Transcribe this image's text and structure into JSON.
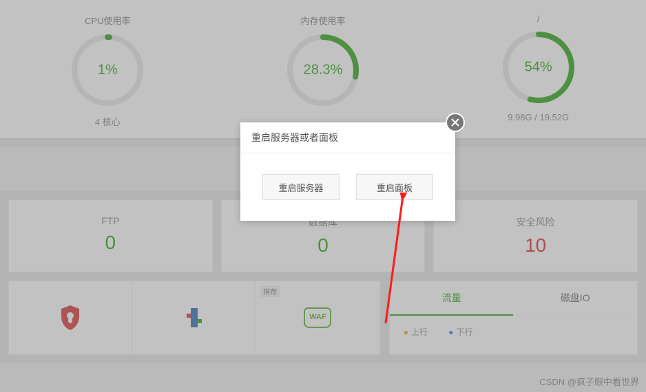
{
  "gauges": {
    "cpu": {
      "title": "CPU使用率",
      "value": "1%",
      "pct": 1,
      "sub": "4 核心"
    },
    "mem": {
      "title": "内存使用率",
      "value": "28.3%",
      "pct": 28.3,
      "sub": ""
    },
    "disk": {
      "title": "/",
      "value": "54%",
      "pct": 54,
      "sub": "9.98G / 19.52G"
    }
  },
  "stats": {
    "ftp": {
      "label": "FTP",
      "value": "0"
    },
    "db": {
      "label": "数据库",
      "value": "0"
    },
    "risk": {
      "label": "安全风险",
      "value": "10"
    }
  },
  "tabs": {
    "traffic": "流量",
    "diskio": "磁盘IO"
  },
  "legend": {
    "up": "上行",
    "down": "下行"
  },
  "apps": {
    "recommend": "推荐",
    "waf": "WAF"
  },
  "modal": {
    "title": "重启服务器或者面板",
    "restart_server": "重启服务器",
    "restart_panel": "重启面板"
  },
  "watermark": "CSDN @疯子眼中看世界",
  "colors": {
    "accent": "#2aa515",
    "danger": "#d92d2d"
  }
}
